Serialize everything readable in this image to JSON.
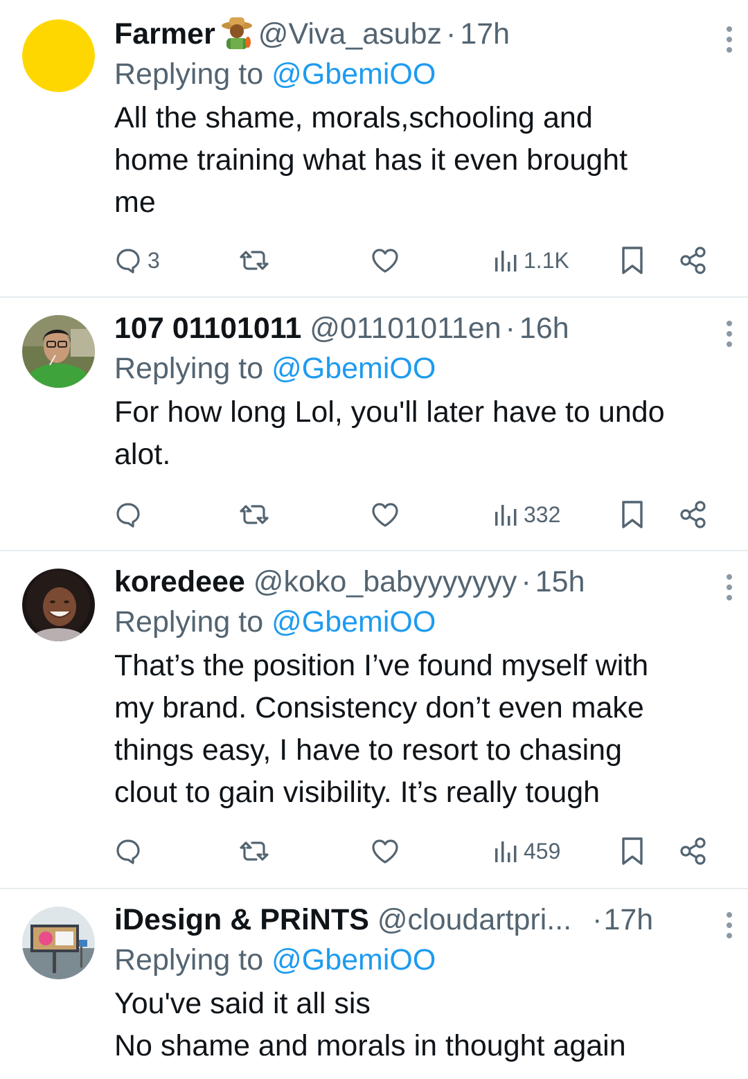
{
  "tweets": [
    {
      "name": "Farmer",
      "name_emoji": "farmer-emoji",
      "handle": "@Viva_asubz",
      "time": "17h",
      "replying_label": "Replying to",
      "replying_to": "@GbemiOO",
      "lines": [
        "All the shame, morals,schooling and",
        "home training what has it even brought",
        "me"
      ],
      "reply_count": "3",
      "views": "1.1K",
      "avatar_color": "#ffd700"
    },
    {
      "name": "107 01101011",
      "handle": "@01101011en",
      "time": "16h",
      "replying_label": "Replying to",
      "replying_to": "@GbemiOO",
      "lines": [
        "For how long Lol, you'll later have to undo",
        "alot."
      ],
      "reply_count": "",
      "views": "332"
    },
    {
      "name": "koredeee",
      "handle": "@koko_babyyyyyyy",
      "time": "15h",
      "replying_label": "Replying to",
      "replying_to": "@GbemiOO",
      "lines": [
        "That’s the position I’ve found myself with",
        "my brand. Consistency don’t even make",
        "things easy, I have to resort to chasing",
        "clout to gain visibility. It’s really tough"
      ],
      "reply_count": "",
      "views": "459"
    },
    {
      "name": "iDesign & PRiNTS",
      "handle": "@cloudartpri...",
      "time": "17h",
      "replying_label": "Replying to",
      "replying_to": "@GbemiOO",
      "lines": [
        "You've said it all sis",
        "No shame and morals in thought again"
      ]
    }
  ],
  "separator": "·",
  "colors": {
    "text": "#0f1419",
    "secondary": "#536471",
    "link": "#1d9bf0",
    "divider": "#e6ecf0"
  },
  "icons": [
    "reply-icon",
    "retweet-icon",
    "like-icon",
    "views-icon",
    "bookmark-icon",
    "share-icon",
    "more-icon"
  ]
}
